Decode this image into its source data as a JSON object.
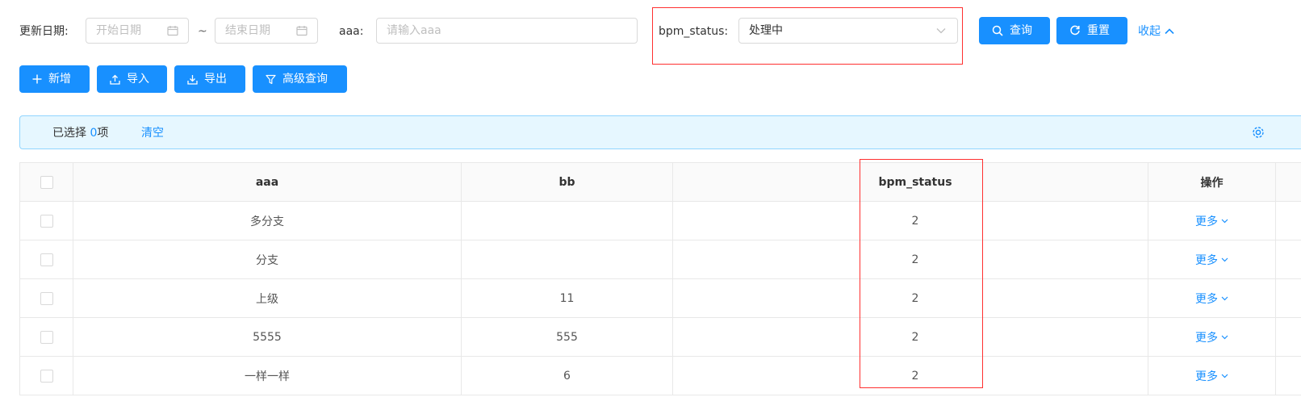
{
  "filters": {
    "update_date_label": "更新日期:",
    "start_date_placeholder": "开始日期",
    "range_sep": "~",
    "end_date_placeholder": "结束日期",
    "aaa_label": "aaa:",
    "aaa_placeholder": "请输入aaa",
    "bpm_status_label": "bpm_status:",
    "bpm_status_value": "处理中"
  },
  "actions": {
    "search": "查询",
    "reset": "重置",
    "collapse": "收起"
  },
  "toolbar": {
    "add": "新增",
    "import": "导入",
    "export": "导出",
    "advanced": "高级查询"
  },
  "selection": {
    "prefix": "已选择",
    "count": "0",
    "suffix": "项",
    "clear": "清空"
  },
  "table": {
    "headers": [
      "aaa",
      "bb",
      "",
      "bpm_status",
      "操作"
    ],
    "more_label": "更多",
    "rows": [
      {
        "aaa": "多分支",
        "bb": "",
        "bpm_status": "2"
      },
      {
        "aaa": "分支",
        "bb": "",
        "bpm_status": "2"
      },
      {
        "aaa": "上级",
        "bb": "11",
        "bpm_status": "2"
      },
      {
        "aaa": "5555",
        "bb": "555",
        "bpm_status": "2"
      },
      {
        "aaa": "一样一样",
        "bb": "6",
        "bpm_status": "2"
      }
    ]
  },
  "colors": {
    "primary": "#1890ff",
    "highlight": "#ff3030",
    "alert_bg": "#e6f7ff"
  },
  "icons": [
    "calendar-icon",
    "chevron-down-icon",
    "search-icon",
    "reload-icon",
    "chevron-up-icon",
    "plus-icon",
    "upload-icon",
    "download-icon",
    "filter-icon",
    "settings-icon"
  ]
}
